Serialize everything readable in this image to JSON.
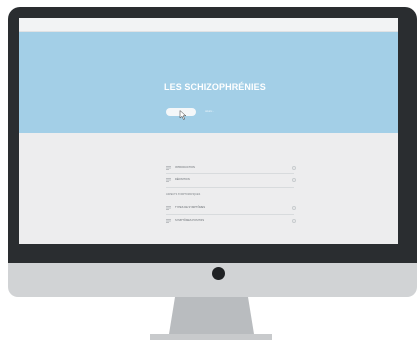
{
  "hero": {
    "title": "LES SCHIZOPHRÉNIES",
    "button_label": "",
    "link_label": "détails  ›"
  },
  "content": {
    "items_top": [
      {
        "label": "INTRODUCTION",
        "icon": "lines-icon"
      },
      {
        "label": "DÉFINITION",
        "icon": "lines-icon"
      }
    ],
    "section_label": "ASPECTS SYMPTOMATIQUES",
    "items_bottom": [
      {
        "label": "TYPES DE SYMPTÔMES",
        "icon": "lines-icon"
      },
      {
        "label": "SYMPTÔMES POSITIFS",
        "icon": "lines-icon"
      }
    ]
  },
  "colors": {
    "frame": "#2a2d30",
    "hero": "#a3cfe7",
    "content": "#ededee",
    "chin": "#d1d3d5",
    "stand": "#b9bcbf"
  }
}
